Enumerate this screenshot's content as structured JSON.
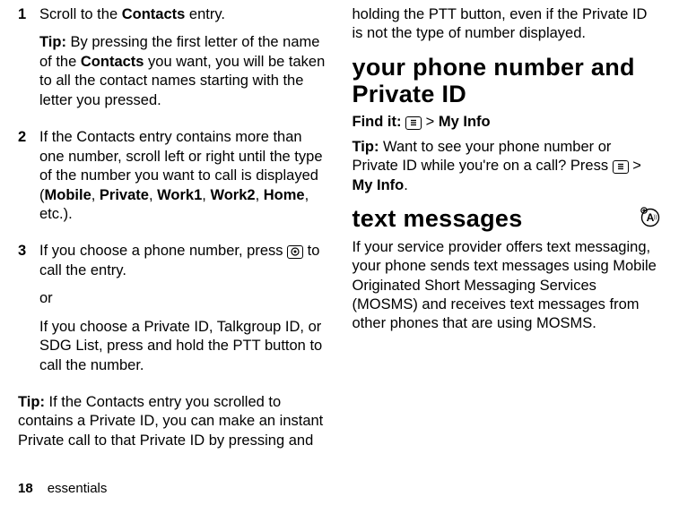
{
  "left": {
    "item1_num": "1",
    "item1_line1a": "Scroll to the ",
    "item1_line1b": "Contacts",
    "item1_line1c": " entry.",
    "item1_tip_label": "Tip:",
    "item1_tip_a": " By pressing the first letter of the name of the ",
    "item1_tip_b": "Contacts",
    "item1_tip_c": " you want, you will be taken to all the contact names starting with the letter you pressed.",
    "item2_num": "2",
    "item2_a": "If the Contacts entry contains more than one number, scroll left or right until the type of the number you want to call is displayed (",
    "item2_m": "Mobile",
    "item2_s1": ", ",
    "item2_p": "Private",
    "item2_s2": ", ",
    "item2_w1": "Work1",
    "item2_s3": ", ",
    "item2_w2": "Work2",
    "item2_s4": ", ",
    "item2_h": "Home",
    "item2_end": ", etc.).",
    "item3_num": "3",
    "item3_a": "If you choose a phone number, press ",
    "item3_key": "◉",
    "item3_b": " to call the entry.",
    "item3_or": "or",
    "item3_c": "If you choose a Private ID, Talkgroup ID, or SDG List, press and hold the PTT button to call the number.",
    "tip2_label": "Tip:",
    "tip2_body": " If the Contacts entry you scrolled to contains a Private ID, you can make an instant Private call to that Private ID by pressing and"
  },
  "right": {
    "cont": "holding the PTT button, even if the Private ID is not the type of number displayed.",
    "h_phone": "your phone number and Private ID",
    "findit_label": "Find it:",
    "findit_sep": " > ",
    "findit_mi": "My Info",
    "tip3_label": "Tip:",
    "tip3_a": " Want to see your phone number or Private ID while you're on a call? Press ",
    "tip3_sep": " > ",
    "tip3_mi": "My Info",
    "tip3_end": ".",
    "h_text": "text messages",
    "tm_body": "If your service provider offers text messaging, your phone sends text messages using Mobile Originated Short Messaging Services (MOSMS) and receives text messages from other phones that are using MOSMS."
  },
  "footer": {
    "page": "18",
    "section": "essentials"
  }
}
